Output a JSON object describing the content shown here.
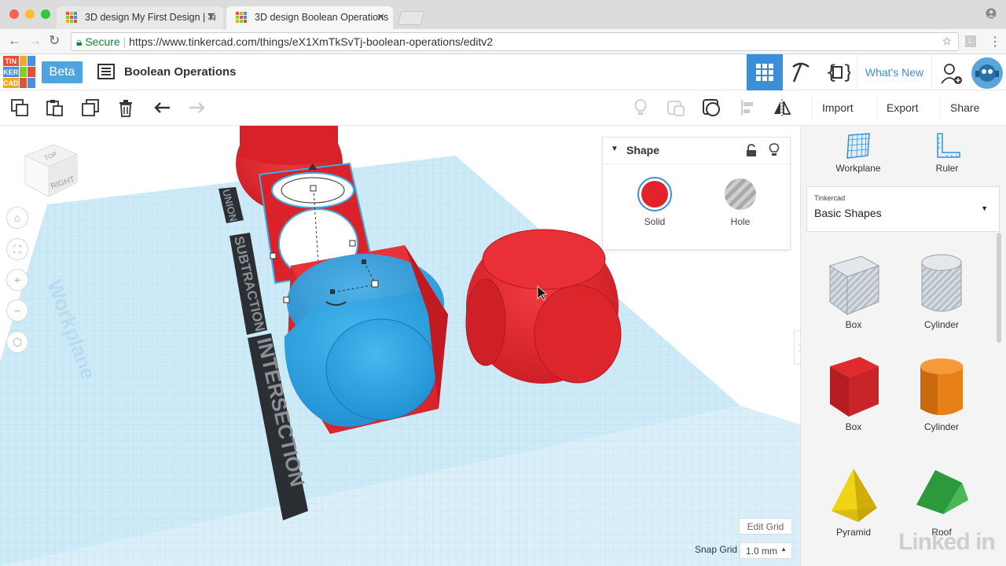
{
  "browser": {
    "tabs": [
      {
        "label": "3D design My First Design | Ti",
        "active": false
      },
      {
        "label": "3D design Boolean Operations",
        "active": true
      }
    ],
    "secure_label": "Secure",
    "url": "https://www.tinkercad.com/things/eX1XmTkSvTj-boolean-operations/editv2"
  },
  "header": {
    "logo_letters": [
      "TIN",
      "KER",
      "CAD"
    ],
    "beta_label": "Beta",
    "design_title": "Boolean Operations",
    "whats_new_label": "What's New"
  },
  "toolbar": {
    "import_label": "Import",
    "export_label": "Export",
    "share_label": "Share"
  },
  "viewcube": {
    "top_label": "TOP",
    "right_label": "RIGHT"
  },
  "workplane_watermark": "Workplane",
  "scene_labels": {
    "union": "UNION",
    "subtraction": "SUBTRACTION",
    "intersection": "INTERSECTION"
  },
  "shape_panel": {
    "title": "Shape",
    "solid_label": "Solid",
    "hole_label": "Hole",
    "solid_color": "#e4222b"
  },
  "grid": {
    "edit_grid_label": "Edit Grid",
    "snap_grid_label": "Snap Grid",
    "snap_grid_value": "1.0 mm"
  },
  "sidebar": {
    "workplane_label": "Workplane",
    "ruler_label": "Ruler",
    "library_source": "Tinkercad",
    "library_name": "Basic Shapes",
    "shapes": [
      {
        "name": "Box",
        "kind": "hole-box"
      },
      {
        "name": "Cylinder",
        "kind": "hole-cylinder"
      },
      {
        "name": "Box",
        "kind": "red-box"
      },
      {
        "name": "Cylinder",
        "kind": "orange-cylinder"
      },
      {
        "name": "Pyramid",
        "kind": "pyramid"
      },
      {
        "name": "Roof",
        "kind": "roof"
      }
    ]
  },
  "watermark": "Linked in"
}
